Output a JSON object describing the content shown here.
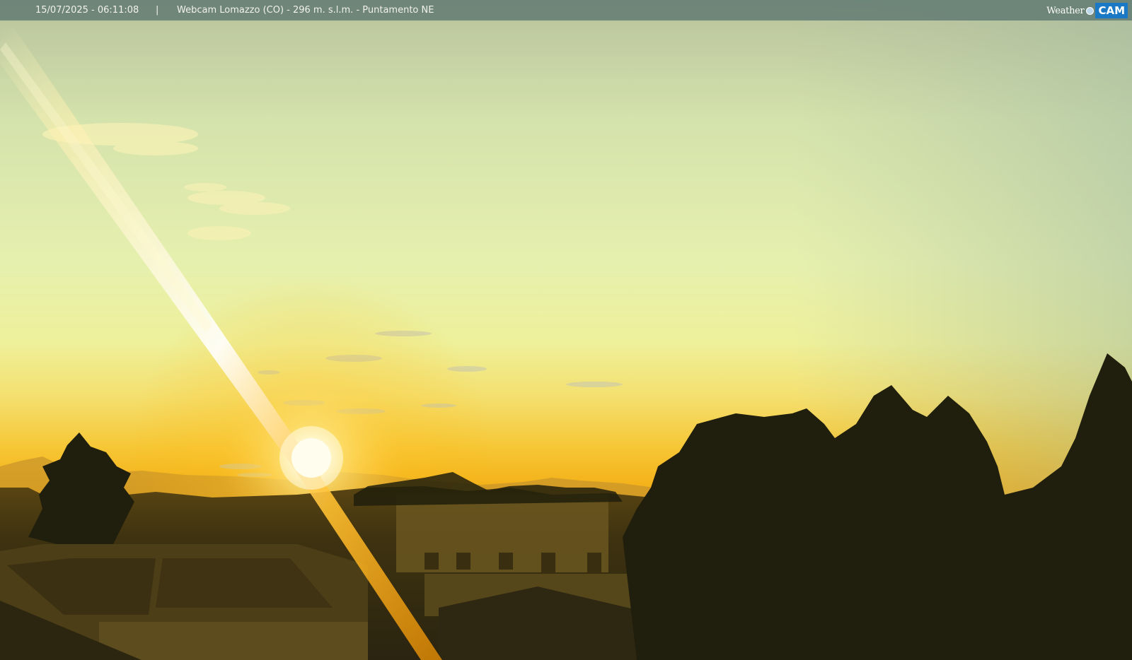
{
  "overlay": {
    "timestamp": "15/07/2025 - 06:11:08",
    "separator": "|",
    "title": "Webcam Lomazzo (CO) - 296 m. s.l.m. - Puntamento NE"
  },
  "logo": {
    "weather_text": "Weather",
    "cam_text": "CAM",
    "brand_color": "#1a78c4"
  },
  "scene": {
    "description_colors": {
      "sky_top": "#b9c49c",
      "sky_mid": "#eaf0a8",
      "sky_horizon": "#f6b81c",
      "sun": "#fffde8",
      "silhouette": "#1e1c0e"
    }
  }
}
